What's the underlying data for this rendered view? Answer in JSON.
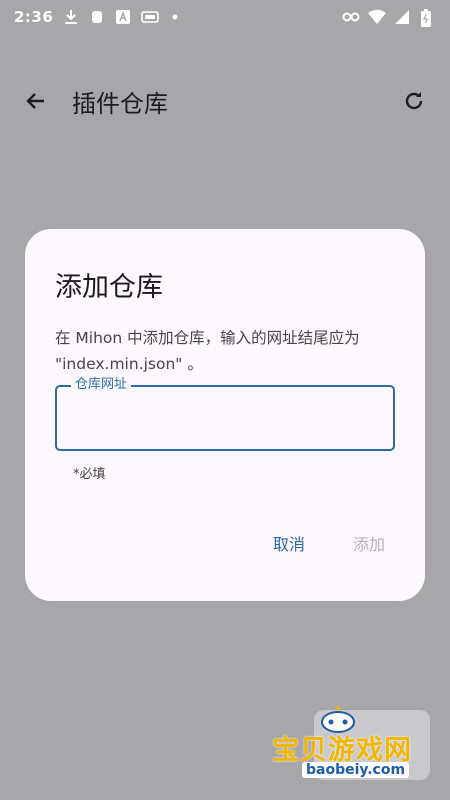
{
  "status_bar": {
    "time": "2:36",
    "icons": [
      "download-icon",
      "app-icon",
      "a-icon",
      "cast-icon",
      "dot-icon",
      "key-icon",
      "wifi-icon",
      "signal-icon",
      "battery-icon"
    ]
  },
  "app_bar": {
    "title": "插件仓库"
  },
  "dialog": {
    "title": "添加仓库",
    "body": "在 Mihon 中添加仓库，输入的网址结尾应为 \"index.min.json\" 。",
    "field_label": "仓库网址",
    "field_value": "",
    "required_note": "*必填",
    "cancel_label": "取消",
    "add_label": "添加"
  },
  "watermark": {
    "text": "宝贝游戏网",
    "domain": "baobeiy.com"
  },
  "colors": {
    "scrim": "#a7a6a9",
    "dialog_bg": "#fcf8fd",
    "accent": "#2f6aa8",
    "disabled": "#b4b1b8"
  }
}
